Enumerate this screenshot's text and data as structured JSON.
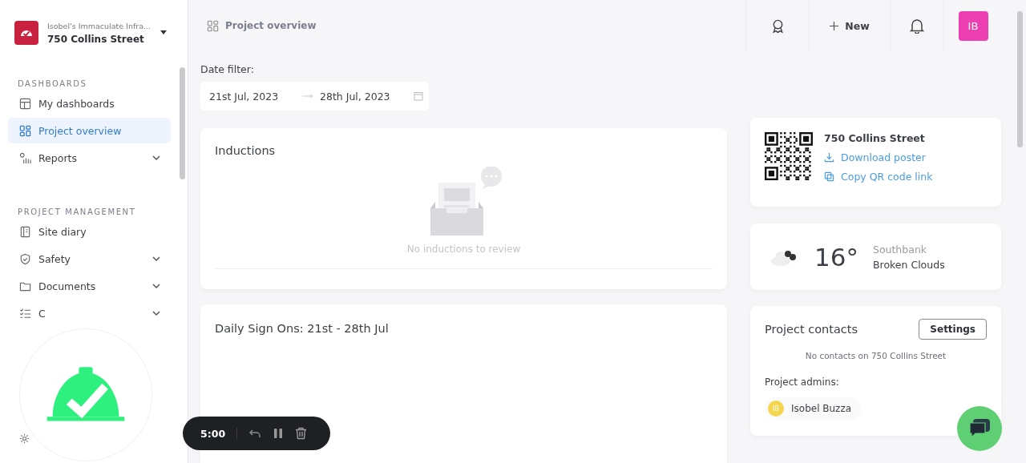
{
  "org": {
    "name": "Isobel's Immaculate Infra...",
    "project": "750 Collins Street"
  },
  "sidebar": {
    "sections": [
      {
        "title": "DASHBOARDS",
        "items": [
          {
            "label": "My dashboards",
            "selected": false,
            "expandable": false
          },
          {
            "label": "Project overview",
            "selected": true,
            "expandable": false
          },
          {
            "label": "Reports",
            "selected": false,
            "expandable": true
          }
        ]
      },
      {
        "title": "PROJECT MANAGEMENT",
        "items": [
          {
            "label": "Site diary",
            "selected": false,
            "expandable": false
          },
          {
            "label": "Safety",
            "selected": false,
            "expandable": true
          },
          {
            "label": "Documents",
            "selected": false,
            "expandable": true
          },
          {
            "label": "C",
            "selected": false,
            "expandable": true
          }
        ]
      }
    ]
  },
  "header": {
    "breadcrumb": "Project overview",
    "new_label": "New",
    "avatar": "IB"
  },
  "date_filter": {
    "label": "Date filter:",
    "start": "21st Jul, 2023",
    "end": "28th Jul, 2023"
  },
  "inductions": {
    "title": "Inductions",
    "empty": "No inductions to review"
  },
  "daily_sign_ons": {
    "title": "Daily Sign Ons: 21st - 28th Jul"
  },
  "qr_card": {
    "title": "750 Collins Street",
    "links": [
      "Download poster",
      "Copy QR code link"
    ]
  },
  "weather": {
    "temperature": "16°",
    "location": "Southbank",
    "condition": "Broken Clouds"
  },
  "contacts": {
    "title": "Project contacts",
    "button": "Settings",
    "empty": "No contacts on 750 Collins Street",
    "admins_label": "Project admins:",
    "admins": [
      {
        "initials": "IB",
        "name": "Isobel Buzza"
      }
    ]
  },
  "recorder": {
    "time": "5:00"
  }
}
